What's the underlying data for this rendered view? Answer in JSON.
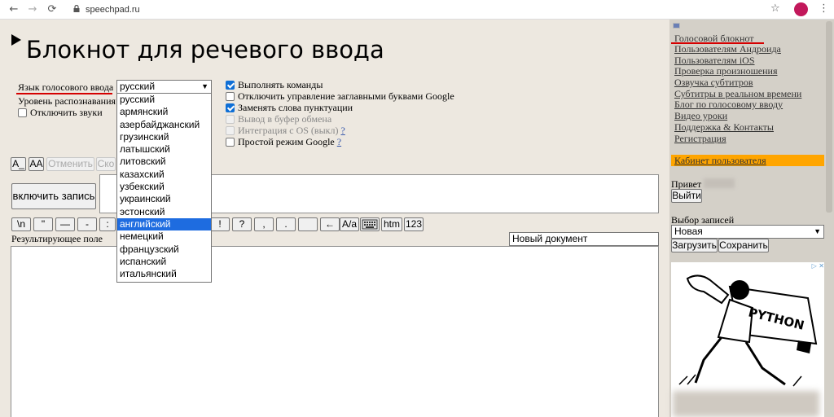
{
  "browser": {
    "url": "speechpad.ru",
    "back_icon": "arrow-left",
    "forward_icon": "arrow-right",
    "reload_icon": "reload",
    "lock_icon": "lock",
    "star_icon": "star",
    "menu_icon": "vertical-dots",
    "profile_color": "#c2185b"
  },
  "page": {
    "title": "Блокнот для речевого ввода"
  },
  "settings": {
    "language_label": "Язык голосового ввода",
    "language_selected": "русский",
    "recognition_label": "Уровень распознавания",
    "mute_sounds_label": "Отключить звуки",
    "languages": [
      "русский",
      "армянский",
      "азербайджанский",
      "грузинский",
      "латышский",
      "литовский",
      "казахский",
      "узбекский",
      "украинский",
      "эстонский",
      "английский",
      "немецкий",
      "французский",
      "испанский",
      "итальянский"
    ],
    "highlighted_language": "английский",
    "options": [
      {
        "label": "Выполнять команды",
        "checked": true,
        "disabled": false
      },
      {
        "label": "Отключить управление заглавными буквами Google",
        "checked": false,
        "disabled": false
      },
      {
        "label": "Заменять слова пунктуации",
        "checked": true,
        "disabled": false
      },
      {
        "label": "Вывод в буфер обмена",
        "checked": false,
        "disabled": true
      },
      {
        "label": "Интеграция с OS (выкл)",
        "checked": false,
        "disabled": true,
        "help": "?"
      },
      {
        "label": "Простой режим Google",
        "checked": false,
        "disabled": false,
        "help": "?"
      }
    ]
  },
  "toolbar": {
    "a_under": "A_",
    "aa": "AA",
    "undo": "Отменить",
    "copy": "Ско",
    "record": "включить запись"
  },
  "punctuation_buttons": [
    "\\n",
    "\"",
    "—",
    "-",
    ":",
    "!",
    "?",
    ",",
    ".",
    "",
    "←",
    "A/a",
    "",
    "htm",
    "123"
  ],
  "result": {
    "label": "Результирующее поле",
    "document_name": "Новый документ"
  },
  "sidebar": {
    "links": [
      "Голосовой блокнот",
      "Пользователям Андроида",
      "Пользователям iOS",
      "Проверка произношения",
      "Озвучка субтитров",
      "Субтитры в реальном времени",
      "Блог по голосовому вводу",
      "Видео уроки",
      "Поддержка & Контакты",
      "Регистрация"
    ],
    "cabinet": "Кабинет пользователя",
    "greeting": "Привет",
    "logout": "Выйти",
    "records_label": "Выбор записей",
    "records_selected": "Новая",
    "load": "Загрузить",
    "save": "Сохранить",
    "ad_text": "PYTHON",
    "accent_color": "#ffa500",
    "underline_color": "#d50000"
  }
}
